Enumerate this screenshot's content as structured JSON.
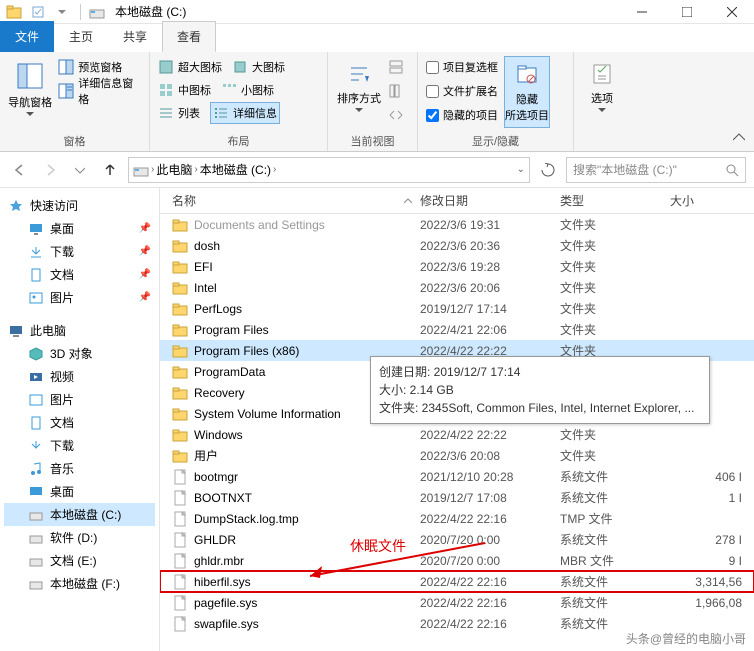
{
  "window": {
    "title": "本地磁盘 (C:)"
  },
  "tabs": {
    "file": "文件",
    "home": "主页",
    "share": "共享",
    "view": "查看"
  },
  "ribbon": {
    "panes": {
      "nav_pane": "导航窗格",
      "preview_pane": "预览窗格",
      "details_pane": "详细信息窗格",
      "group_label": "窗格"
    },
    "layout": {
      "extra_large": "超大图标",
      "large": "大图标",
      "medium": "中图标",
      "small": "小图标",
      "list": "列表",
      "details": "详细信息",
      "group_label": "布局"
    },
    "sort": {
      "sort_by": "排序方式",
      "add_col": "",
      "group_label": "当前视图"
    },
    "show": {
      "item_cb": "项目复选框",
      "ext": "文件扩展名",
      "hidden": "隐藏的项目",
      "hide_sel": "隐藏\n所选项目",
      "group_label": "显示/隐藏"
    },
    "options": "选项"
  },
  "breadcrumb": {
    "seg1": "此电脑",
    "seg2": "本地磁盘 (C:)"
  },
  "search": {
    "placeholder": "搜索\"本地磁盘 (C:)\""
  },
  "tree": {
    "quick": "快速访问",
    "desktop": "桌面",
    "downloads": "下载",
    "documents": "文档",
    "pictures": "图片",
    "thispc": "此电脑",
    "objects3d": "3D 对象",
    "videos": "视频",
    "pictures2": "图片",
    "documents2": "文档",
    "downloads2": "下载",
    "music": "音乐",
    "desktop2": "桌面",
    "cdrive": "本地磁盘 (C:)",
    "ddrive": "软件 (D:)",
    "edrive": "文档 (E:)",
    "fdrive": "本地磁盘 (F:)"
  },
  "columns": {
    "name": "名称",
    "date": "修改日期",
    "type": "类型",
    "size": "大小"
  },
  "rows": [
    {
      "icon": "folder",
      "name": "Documents and Settings",
      "date": "2022/3/6 19:31",
      "type": "文件夹",
      "size": "",
      "cut": true
    },
    {
      "icon": "folder",
      "name": "dosh",
      "date": "2022/3/6 20:36",
      "type": "文件夹",
      "size": ""
    },
    {
      "icon": "folder",
      "name": "EFI",
      "date": "2022/3/6 19:28",
      "type": "文件夹",
      "size": ""
    },
    {
      "icon": "folder",
      "name": "Intel",
      "date": "2022/3/6 20:06",
      "type": "文件夹",
      "size": ""
    },
    {
      "icon": "folder",
      "name": "PerfLogs",
      "date": "2019/12/7 17:14",
      "type": "文件夹",
      "size": ""
    },
    {
      "icon": "folder",
      "name": "Program Files",
      "date": "2022/4/21 22:06",
      "type": "文件夹",
      "size": ""
    },
    {
      "icon": "folder",
      "name": "Program Files (x86)",
      "date": "2022/4/22 22:22",
      "type": "文件夹",
      "size": "",
      "sel": true
    },
    {
      "icon": "folder",
      "name": "ProgramData",
      "date": "",
      "type": "",
      "size": ""
    },
    {
      "icon": "folder",
      "name": "Recovery",
      "date": "",
      "type": "",
      "size": ""
    },
    {
      "icon": "folder",
      "name": "System Volume Information",
      "date": "",
      "type": "",
      "size": ""
    },
    {
      "icon": "folder",
      "name": "Windows",
      "date": "2022/4/22 22:22",
      "type": "文件夹",
      "size": ""
    },
    {
      "icon": "folder",
      "name": "用户",
      "date": "2022/3/6 20:08",
      "type": "文件夹",
      "size": ""
    },
    {
      "icon": "file",
      "name": "bootmgr",
      "date": "2021/12/10 20:28",
      "type": "系统文件",
      "size": "406 I"
    },
    {
      "icon": "file",
      "name": "BOOTNXT",
      "date": "2019/12/7 17:08",
      "type": "系统文件",
      "size": "1 I"
    },
    {
      "icon": "file",
      "name": "DumpStack.log.tmp",
      "date": "2022/4/22 22:16",
      "type": "TMP 文件",
      "size": ""
    },
    {
      "icon": "file",
      "name": "GHLDR",
      "date": "2020/7/20 0:00",
      "type": "系统文件",
      "size": "278 I"
    },
    {
      "icon": "file",
      "name": "ghldr.mbr",
      "date": "2020/7/20 0:00",
      "type": "MBR 文件",
      "size": "9 I"
    },
    {
      "icon": "file",
      "name": "hiberfil.sys",
      "date": "2022/4/22 22:16",
      "type": "系统文件",
      "size": "3,314,56",
      "boxed": true
    },
    {
      "icon": "file",
      "name": "pagefile.sys",
      "date": "2022/4/22 22:16",
      "type": "系统文件",
      "size": "1,966,08"
    },
    {
      "icon": "file",
      "name": "swapfile.sys",
      "date": "2022/4/22 22:16",
      "type": "系统文件",
      "size": ""
    }
  ],
  "tooltip": {
    "line1": "创建日期: 2019/12/7 17:14",
    "line2": "大小: 2.14 GB",
    "line3": "文件夹: 2345Soft, Common Files, Intel, Internet Explorer, ..."
  },
  "annotation": {
    "label": "休眠文件"
  },
  "watermark": "头条@曾经的电脑小哥"
}
